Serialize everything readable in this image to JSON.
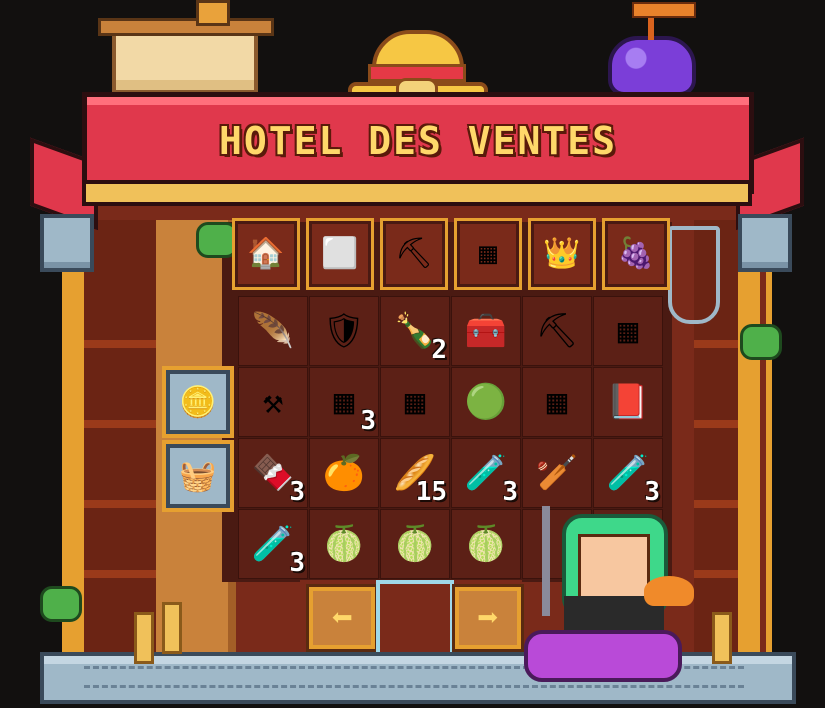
{
  "banner": {
    "title": "HOTEL DES VENTES"
  },
  "category_tabs": [
    {
      "name": "home",
      "icon": "house-icon",
      "glyph": "🏠"
    },
    {
      "name": "blocks",
      "icon": "slime-block-icon",
      "glyph": "⬜"
    },
    {
      "name": "tools",
      "icon": "pickaxe-icon",
      "glyph": "⛏"
    },
    {
      "name": "spawners",
      "icon": "spawner-icon",
      "glyph": "▦"
    },
    {
      "name": "mobs",
      "icon": "crowned-skeleton-icon",
      "glyph": "👑"
    },
    {
      "name": "fruits",
      "icon": "devil-fruit-icon",
      "glyph": "🍇"
    }
  ],
  "side_buttons": [
    {
      "icon": "gold-coin-icon",
      "glyph": "🪙"
    },
    {
      "icon": "fruit-basket-icon",
      "glyph": "🧺"
    }
  ],
  "items": [
    [
      {
        "icon": "feather-icon",
        "glyph": "🪶",
        "qty": ""
      },
      {
        "icon": "pink-chestplate-icon",
        "glyph": "🛡",
        "qty": ""
      },
      {
        "icon": "potion-bottle-skull-icon",
        "glyph": "🍾",
        "qty": "2"
      },
      {
        "icon": "chest-icon",
        "glyph": "🧰",
        "qty": ""
      },
      {
        "icon": "diamond-pickaxe-icon",
        "glyph": "⛏",
        "qty": ""
      },
      {
        "icon": "spawner-cage-icon",
        "glyph": "▦",
        "qty": ""
      }
    ],
    [
      {
        "icon": "anvil-stack-icon",
        "glyph": "⚒",
        "qty": ""
      },
      {
        "icon": "spawner-cage-icon",
        "glyph": "▦",
        "qty": "3"
      },
      {
        "icon": "spawner-cage-icon",
        "glyph": "▦",
        "qty": ""
      },
      {
        "icon": "emerald-icon",
        "glyph": "🟢",
        "qty": ""
      },
      {
        "icon": "spawner-cage-icon",
        "glyph": "▦",
        "qty": ""
      },
      {
        "icon": "book-icon",
        "glyph": "📕",
        "qty": ""
      }
    ],
    [
      {
        "icon": "chocolate-bar-icon",
        "glyph": "🍫",
        "qty": "3"
      },
      {
        "icon": "orange-devil-fruit-icon",
        "glyph": "🍊",
        "qty": ""
      },
      {
        "icon": "bread-icon",
        "glyph": "🥖",
        "qty": "15"
      },
      {
        "icon": "orange-potion-icon",
        "glyph": "🧪",
        "qty": "3"
      },
      {
        "icon": "spiked-club-icon",
        "glyph": "🏏",
        "qty": ""
      },
      {
        "icon": "orange-potion-icon",
        "glyph": "🧪",
        "qty": "3"
      }
    ],
    [
      {
        "icon": "orange-potion-icon",
        "glyph": "🧪",
        "qty": "3"
      },
      {
        "icon": "green-devil-fruit-icon",
        "glyph": "🍈",
        "qty": ""
      },
      {
        "icon": "green-devil-fruit-icon",
        "glyph": "🍈",
        "qty": ""
      },
      {
        "icon": "green-devil-fruit-icon",
        "glyph": "🍈",
        "qty": ""
      },
      {
        "icon": "empty-slot",
        "glyph": "",
        "qty": ""
      },
      {
        "icon": "empty-slot",
        "glyph": "",
        "qty": ""
      }
    ]
  ],
  "pager": {
    "prev_glyph": "⬅",
    "next_glyph": "➡"
  },
  "colors": {
    "banner": "#e0384c",
    "title": "#ffd86a",
    "frame": "#e6a030",
    "slot": "#5c2016"
  }
}
